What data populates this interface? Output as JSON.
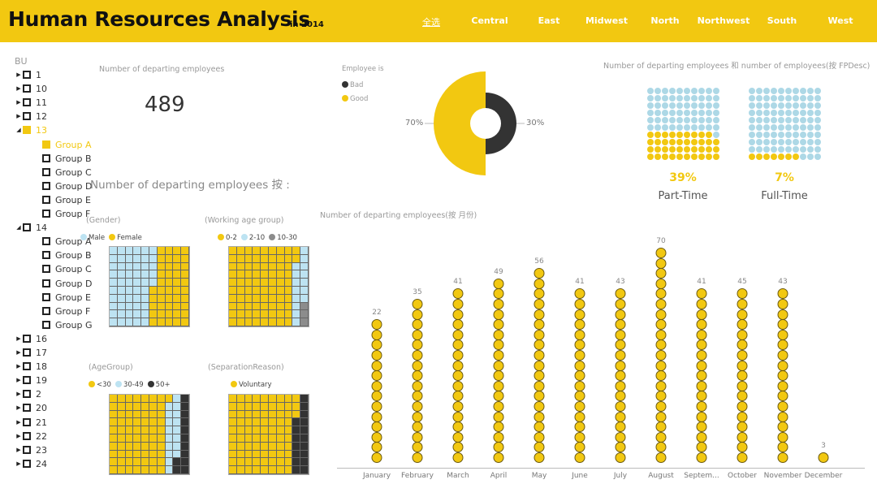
{
  "header": {
    "title": "Human Resources Analysis",
    "subtitle": "in 2014",
    "regions": [
      "全选",
      "Central",
      "East",
      "Midwest",
      "North",
      "Northwest",
      "South",
      "West"
    ]
  },
  "colors": {
    "accent": "#F2C811",
    "blue": "#BDE3F2",
    "dark": "#333333",
    "gray": "#8c8c8c"
  },
  "sidebar": {
    "title": "BU",
    "items": [
      {
        "label": "1",
        "level": 0,
        "arrow": "right"
      },
      {
        "label": "10",
        "level": 0,
        "arrow": "right"
      },
      {
        "label": "11",
        "level": 0,
        "arrow": "right"
      },
      {
        "label": "12",
        "level": 0,
        "arrow": "right"
      },
      {
        "label": "13",
        "level": 0,
        "arrow": "down",
        "selected": true
      },
      {
        "label": "Group A",
        "level": 1,
        "selected": true
      },
      {
        "label": "Group B",
        "level": 1
      },
      {
        "label": "Group C",
        "level": 1
      },
      {
        "label": "Group D",
        "level": 1
      },
      {
        "label": "Group E",
        "level": 1
      },
      {
        "label": "Group F",
        "level": 1
      },
      {
        "label": "14",
        "level": 0,
        "arrow": "down"
      },
      {
        "label": "Group A",
        "level": 1
      },
      {
        "label": "Group B",
        "level": 1
      },
      {
        "label": "Group C",
        "level": 1
      },
      {
        "label": "Group D",
        "level": 1
      },
      {
        "label": "Group E",
        "level": 1
      },
      {
        "label": "Group F",
        "level": 1
      },
      {
        "label": "Group G",
        "level": 1
      },
      {
        "label": "16",
        "level": 0,
        "arrow": "right"
      },
      {
        "label": "17",
        "level": 0,
        "arrow": "right"
      },
      {
        "label": "18",
        "level": 0,
        "arrow": "right"
      },
      {
        "label": "19",
        "level": 0,
        "arrow": "right"
      },
      {
        "label": "2",
        "level": 0,
        "arrow": "right"
      },
      {
        "label": "20",
        "level": 0,
        "arrow": "right"
      },
      {
        "label": "21",
        "level": 0,
        "arrow": "right"
      },
      {
        "label": "22",
        "level": 0,
        "arrow": "right"
      },
      {
        "label": "23",
        "level": 0,
        "arrow": "right"
      },
      {
        "label": "24",
        "level": 0,
        "arrow": "right"
      }
    ]
  },
  "kpi": {
    "label": "Number of departing employees",
    "value": "489"
  },
  "breakdown_title": "Number of departing employees 按 :",
  "chart_data": [
    {
      "type": "pie",
      "title": "",
      "legend_title": "Employee is",
      "slices": [
        {
          "name": "Bad",
          "value": 30,
          "label": "30%",
          "color": "#333333"
        },
        {
          "name": "Good",
          "value": 70,
          "label": "70%",
          "color": "#F2C811"
        }
      ]
    },
    {
      "type": "waffle",
      "title": "(Gender)",
      "series": [
        {
          "name": "Male",
          "value": 55,
          "color": "#BDE3F2"
        },
        {
          "name": "Female",
          "value": 45,
          "color": "#F2C811"
        }
      ]
    },
    {
      "type": "waffle",
      "title": "(Working age group)",
      "series": [
        {
          "name": "0-2",
          "value": 82,
          "color": "#F2C811"
        },
        {
          "name": "2-10",
          "value": 15,
          "color": "#BDE3F2"
        },
        {
          "name": "10-30",
          "value": 3,
          "color": "#8c8c8c"
        }
      ]
    },
    {
      "type": "waffle",
      "title": "(AgeGroup)",
      "series": [
        {
          "name": "<30",
          "value": 71,
          "color": "#F2C811"
        },
        {
          "name": "30-49",
          "value": 17,
          "color": "#BDE3F2"
        },
        {
          "name": "50+",
          "value": 12,
          "color": "#333333"
        }
      ]
    },
    {
      "type": "waffle",
      "title": "(SeparationReason)",
      "series": [
        {
          "name": "Voluntary",
          "value": 83,
          "color": "#F2C811"
        },
        {
          "name": "",
          "value": 17,
          "color": "#333333"
        }
      ]
    },
    {
      "type": "waffle",
      "title": "Number of departing employees 和 number of employees(按 FPDesc)",
      "panels": [
        {
          "name": "Part-Time",
          "value": 39,
          "label": "39%"
        },
        {
          "name": "Full-Time",
          "value": 7,
          "label": "7%"
        }
      ]
    },
    {
      "type": "bar",
      "title": "Number of departing employees(按 月份)",
      "categories": [
        "January",
        "February",
        "March",
        "April",
        "May",
        "June",
        "July",
        "August",
        "Septem...",
        "October",
        "November",
        "December"
      ],
      "values": [
        22,
        35,
        41,
        49,
        56,
        41,
        43,
        70,
        41,
        45,
        43,
        3
      ]
    }
  ]
}
